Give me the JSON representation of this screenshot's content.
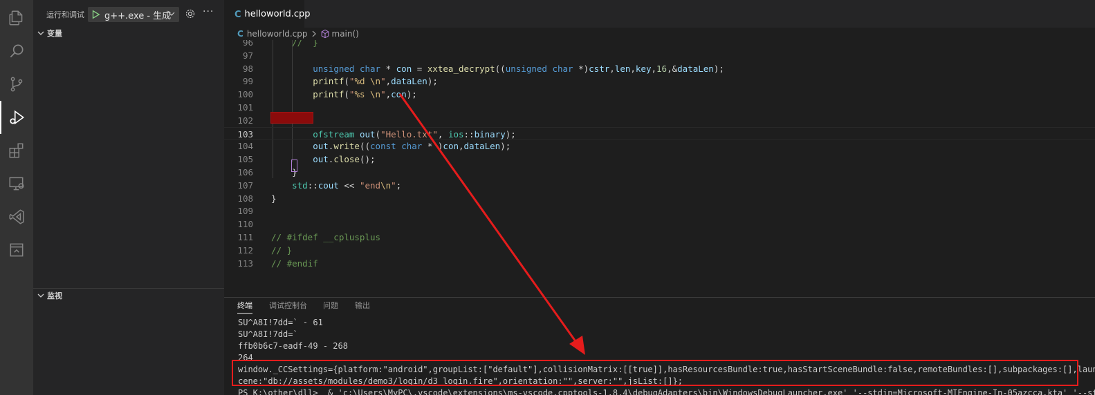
{
  "sidebar": {
    "title": "运行和调试",
    "run_config": "g++.exe - 生成",
    "sections": {
      "variables": "变量",
      "watch": "监视"
    }
  },
  "editor": {
    "tab_label": "helloworld.cpp",
    "breadcrumb_file": "helloworld.cpp",
    "breadcrumb_symbol": "main()",
    "lines": [
      {
        "n": "96",
        "text": "//  }"
      },
      {
        "n": "97",
        "text": ""
      },
      {
        "n": "98",
        "text": "unsigned char * con = xxtea_decrypt((unsigned char *)cstr,len,key,16,&dataLen);"
      },
      {
        "n": "99",
        "text": "printf(\"%d \\n\",dataLen);"
      },
      {
        "n": "100",
        "text": "printf(\"%s \\n\",con);"
      },
      {
        "n": "101",
        "text": ""
      },
      {
        "n": "102",
        "text": ""
      },
      {
        "n": "103",
        "text": "ofstream out(\"Hello.txt\", ios::binary);"
      },
      {
        "n": "104",
        "text": "out.write((const char * )con,dataLen);"
      },
      {
        "n": "105",
        "text": "out.close();"
      },
      {
        "n": "106",
        "text": "}"
      },
      {
        "n": "107",
        "text": "std::cout << \"end\\n\";"
      },
      {
        "n": "108",
        "text": "}"
      },
      {
        "n": "109",
        "text": ""
      },
      {
        "n": "110",
        "text": ""
      },
      {
        "n": "111",
        "text": "// #ifdef __cplusplus"
      },
      {
        "n": "112",
        "text": "// }"
      },
      {
        "n": "113",
        "text": "// #endif"
      }
    ]
  },
  "panel": {
    "tabs": [
      "终端",
      "调试控制台",
      "问题",
      "输出"
    ],
    "terminal": [
      "SU^A8I!7dd=` - 61",
      "SU^A8I!7dd=`",
      "ffb0b6c7-eadf-49 - 268",
      "264",
      "window._CCSettings={platform:\"android\",groupList:[\"default\"],collisionMatrix:[[true]],hasResourcesBundle:true,hasStartSceneBundle:false,remoteBundles:[],subpackages:[],launchS",
      "cene:\"db://assets/modules/demo3/login/d3 login.fire\",orientation:\"\",server:\"\",jsList:[]};",
      "PS K:\\other\\dll>  & 'c:\\Users\\MyPC\\.vscode\\extensions\\ms-vscode.cpptools-1.8.4\\debugAdapters\\bin\\WindowsDebugLauncher.exe' '--stdin=Microsoft-MIEngine-In-05azcca.kta' '--stdo"
    ]
  },
  "colors": {
    "accent_red": "#e51c1c",
    "breakpoint": "#8b0b0b"
  }
}
